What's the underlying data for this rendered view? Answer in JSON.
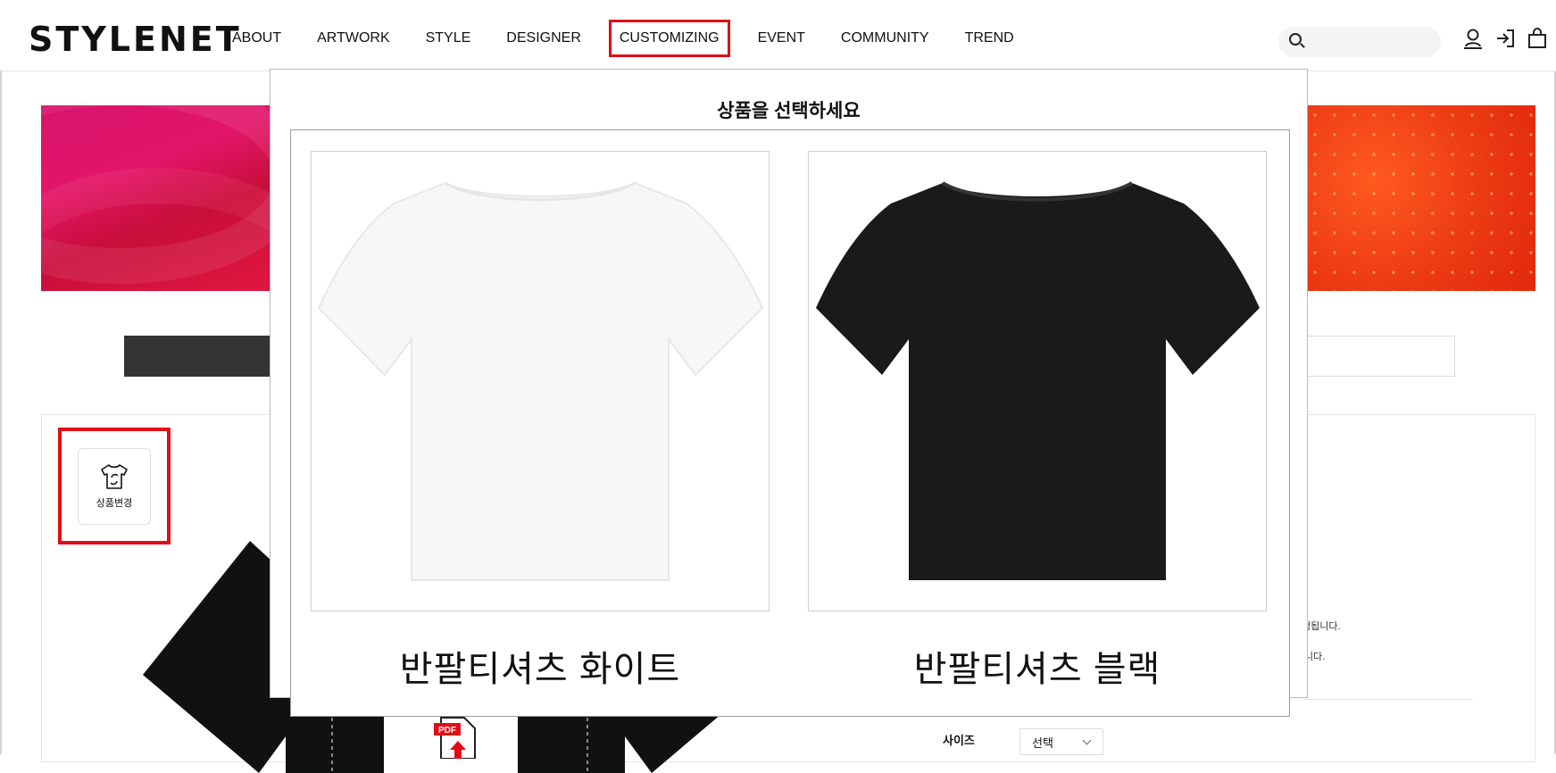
{
  "header": {
    "logo": "STYLENET",
    "nav": [
      {
        "label": "ABOUT"
      },
      {
        "label": "ARTWORK"
      },
      {
        "label": "STYLE"
      },
      {
        "label": "DESIGNER"
      },
      {
        "label": "CUSTOMIZING",
        "active": true
      },
      {
        "label": "EVENT"
      },
      {
        "label": "COMMUNITY"
      },
      {
        "label": "TREND"
      }
    ],
    "search_placeholder": "",
    "icons": [
      "user-icon",
      "login-icon",
      "cart-icon"
    ]
  },
  "page": {
    "change_product_label": "상품변경",
    "side_text_1": "쟁됩니다.",
    "side_text_2": "니다.",
    "size_label": "사이즈",
    "size_value": "선택",
    "pdf_badge": "PDF"
  },
  "modal": {
    "title": "상품을 선택하세요",
    "products": [
      {
        "label": "반팔티셔츠 화이트",
        "color": "#f7f7f7"
      },
      {
        "label": "반팔티셔츠 블랙",
        "color": "#1a1a1a"
      }
    ]
  },
  "colors": {
    "highlight": "#e10d16",
    "banner_left": "#d8126c",
    "banner_right": "#ec3a14"
  }
}
